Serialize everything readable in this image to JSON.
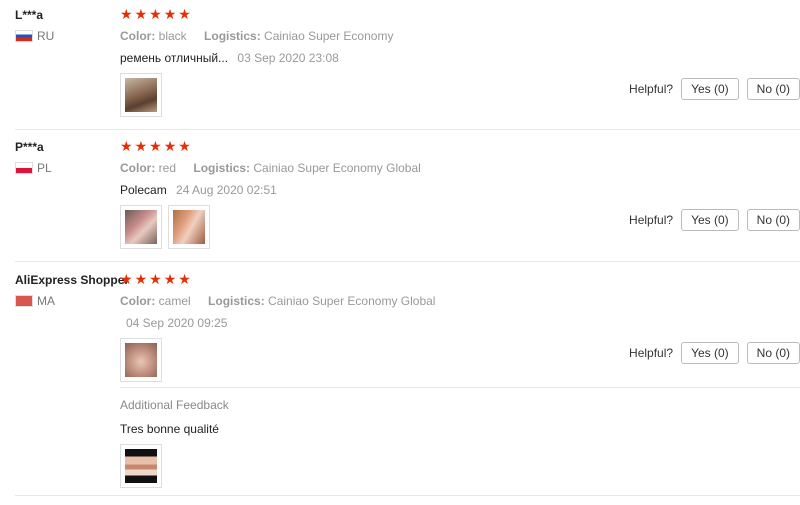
{
  "reviews": [
    {
      "user": "L***a",
      "country": "RU",
      "stars": 5,
      "color_label": "Color:",
      "color": "black",
      "logistics_label": "Logistics:",
      "logistics": "Cainiao Super Economy",
      "feedback": "ремень отличный...",
      "date": "03 Sep 2020 23:08",
      "helpful_label": "Helpful?",
      "yes": "Yes (0)",
      "no": "No (0)"
    },
    {
      "user": "P***a",
      "country": "PL",
      "stars": 5,
      "color_label": "Color:",
      "color": "red",
      "logistics_label": "Logistics:",
      "logistics": "Cainiao Super Economy Global",
      "feedback": "Polecam",
      "date": "24 Aug 2020 02:51",
      "helpful_label": "Helpful?",
      "yes": "Yes (0)",
      "no": "No (0)"
    },
    {
      "user": "AliExpress Shopper",
      "country": "MA",
      "stars": 5,
      "color_label": "Color:",
      "color": "camel",
      "logistics_label": "Logistics:",
      "logistics": "Cainiao Super Economy Global",
      "feedback": "",
      "date": "04 Sep 2020 09:25",
      "helpful_label": "Helpful?",
      "yes": "Yes (0)",
      "no": "No (0)",
      "additional_title": "Additional Feedback",
      "additional_text": "Tres bonne qualité"
    }
  ],
  "star_glyph": "★",
  "colors": {
    "star": "#e62e04",
    "muted": "#999999",
    "border": "#e8e8e8"
  }
}
